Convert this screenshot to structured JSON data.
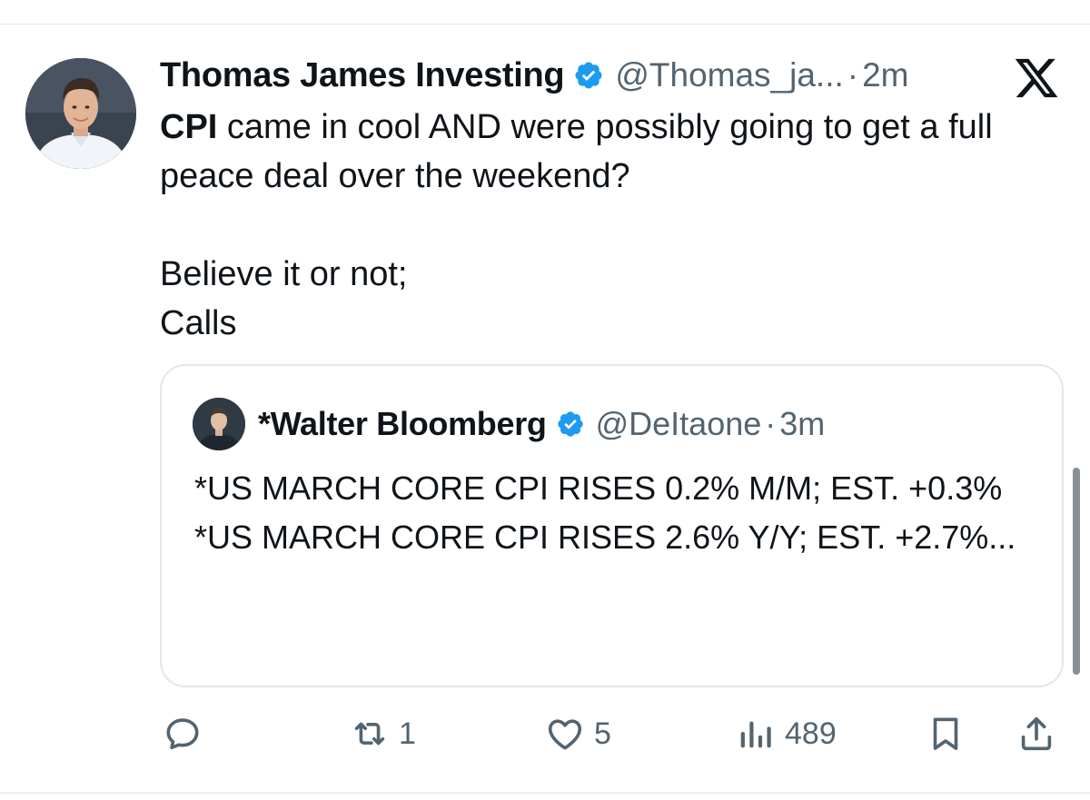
{
  "tweet": {
    "author": {
      "display_name": "Thomas James Investing",
      "handle": "@Thomas_ja...",
      "separator": "·",
      "time": "2m"
    },
    "text": {
      "line1_bold": "CPI",
      "line1_rest": " came in cool AND were possibly going to get a full peace deal over the weekend?",
      "line2": "Believe it or not;",
      "line3": "Calls"
    },
    "platform_icon": "x-logo-icon"
  },
  "quote": {
    "author": {
      "display_name": "*Walter Bloomberg",
      "handle": "@DeItaone",
      "separator": "·",
      "time": "3m"
    },
    "lines": [
      "*US MARCH CORE CPI RISES 0.2% M/M; EST. +0.3%",
      "*US MARCH CORE CPI RISES 2.6% Y/Y; EST. +2.7%..."
    ]
  },
  "actions": {
    "reply": {
      "icon": "reply-icon",
      "count": ""
    },
    "repost": {
      "icon": "repost-icon",
      "count": "1"
    },
    "like": {
      "icon": "heart-icon",
      "count": "5"
    },
    "views": {
      "icon": "views-chart-icon",
      "count": "489"
    },
    "bookmark": {
      "icon": "bookmark-icon"
    },
    "share": {
      "icon": "share-icon"
    }
  },
  "colors": {
    "text": "#0f1419",
    "secondary_text": "#536471",
    "verified_blue": "#1d9bf0",
    "border": "#e1e8ed"
  }
}
